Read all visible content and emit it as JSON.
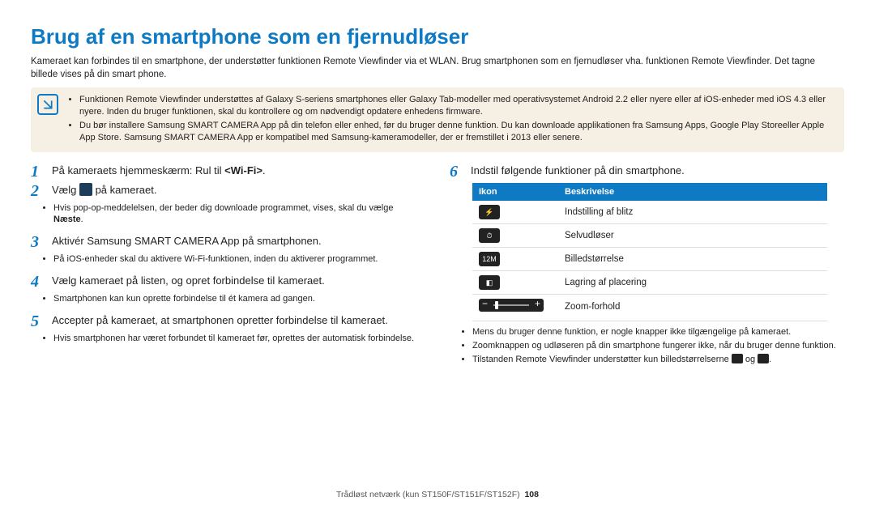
{
  "title": "Brug af en smartphone som en fjernudløser",
  "intro": "Kameraet kan forbindes til en smartphone, der understøtter funktionen Remote Viewfinder via et WLAN. Brug smartphonen som en fjernudløser vha. funktionen Remote Viewfinder. Det tagne billede vises på din smart phone.",
  "note": {
    "items": [
      "Funktionen Remote Viewfinder understøttes af Galaxy S-seriens smartphones eller Galaxy Tab-modeller med operativsystemet Android 2.2 eller nyere eller af iOS-enheder med iOS 4.3 eller nyere. Inden du bruger funktionen, skal du kontrollere og om nødvendigt opdatere enhedens firmware.",
      "Du bør installere Samsung SMART CAMERA App på din telefon eller enhed, før du bruger denne funktion. Du kan downloade applikationen fra Samsung Apps, Google Play Storeeller Apple App Store. Samsung SMART CAMERA App er kompatibel med Samsung-kameramodeller, der er fremstillet i 2013 eller senere."
    ]
  },
  "steps": {
    "s1": {
      "pre": "På kameraets hjemmeskærm: Rul til ",
      "bold": "<Wi-Fi>",
      "post": "."
    },
    "s2": {
      "pre": "Vælg ",
      "post": " på kameraet."
    },
    "s2_sub": {
      "pre": "Hvis pop-op-meddelelsen, der beder dig downloade programmet, vises, skal du vælge ",
      "bold": "Næste",
      "post": "."
    },
    "s3": "Aktivér Samsung SMART CAMERA App på smartphonen.",
    "s3_sub": "På iOS-enheder skal du aktivere Wi-Fi-funktionen, inden du aktiverer programmet.",
    "s4": "Vælg kameraet på listen, og opret forbindelse til kameraet.",
    "s4_sub": "Smartphonen kan kun oprette forbindelse til ét kamera ad gangen.",
    "s5": "Accepter på kameraet, at smartphonen opretter forbindelse til kameraet.",
    "s5_sub": "Hvis smartphonen har været forbundet til kameraet før, oprettes der automatisk forbindelse.",
    "s6": "Indstil følgende funktioner på din smartphone."
  },
  "table": {
    "headers": {
      "icon": "Ikon",
      "desc": "Beskrivelse"
    },
    "rows": [
      {
        "icon_name": "flash-icon",
        "desc": "Indstilling af blitz"
      },
      {
        "icon_name": "timer-icon",
        "desc": "Selvudløser"
      },
      {
        "icon_name": "size-icon",
        "desc": "Billedstørrelse"
      },
      {
        "icon_name": "location-icon",
        "desc": "Lagring af placering"
      },
      {
        "icon_name": "zoom-bar",
        "desc": "Zoom-forhold"
      }
    ]
  },
  "post_notes": [
    "Mens du bruger denne funktion, er nogle knapper ikke tilgængelige på kameraet.",
    "Zoomknappen og udløseren på din smartphone fungerer ikke, når du bruger denne funktion."
  ],
  "post_note_last": {
    "pre": "Tilstanden Remote Viewfinder understøtter kun billedstørrelserne ",
    "mid": " og ",
    "post": "."
  },
  "footer": {
    "section": "Trådløst netværk (kun ST150F/ST151F/ST152F)",
    "page": "108"
  }
}
